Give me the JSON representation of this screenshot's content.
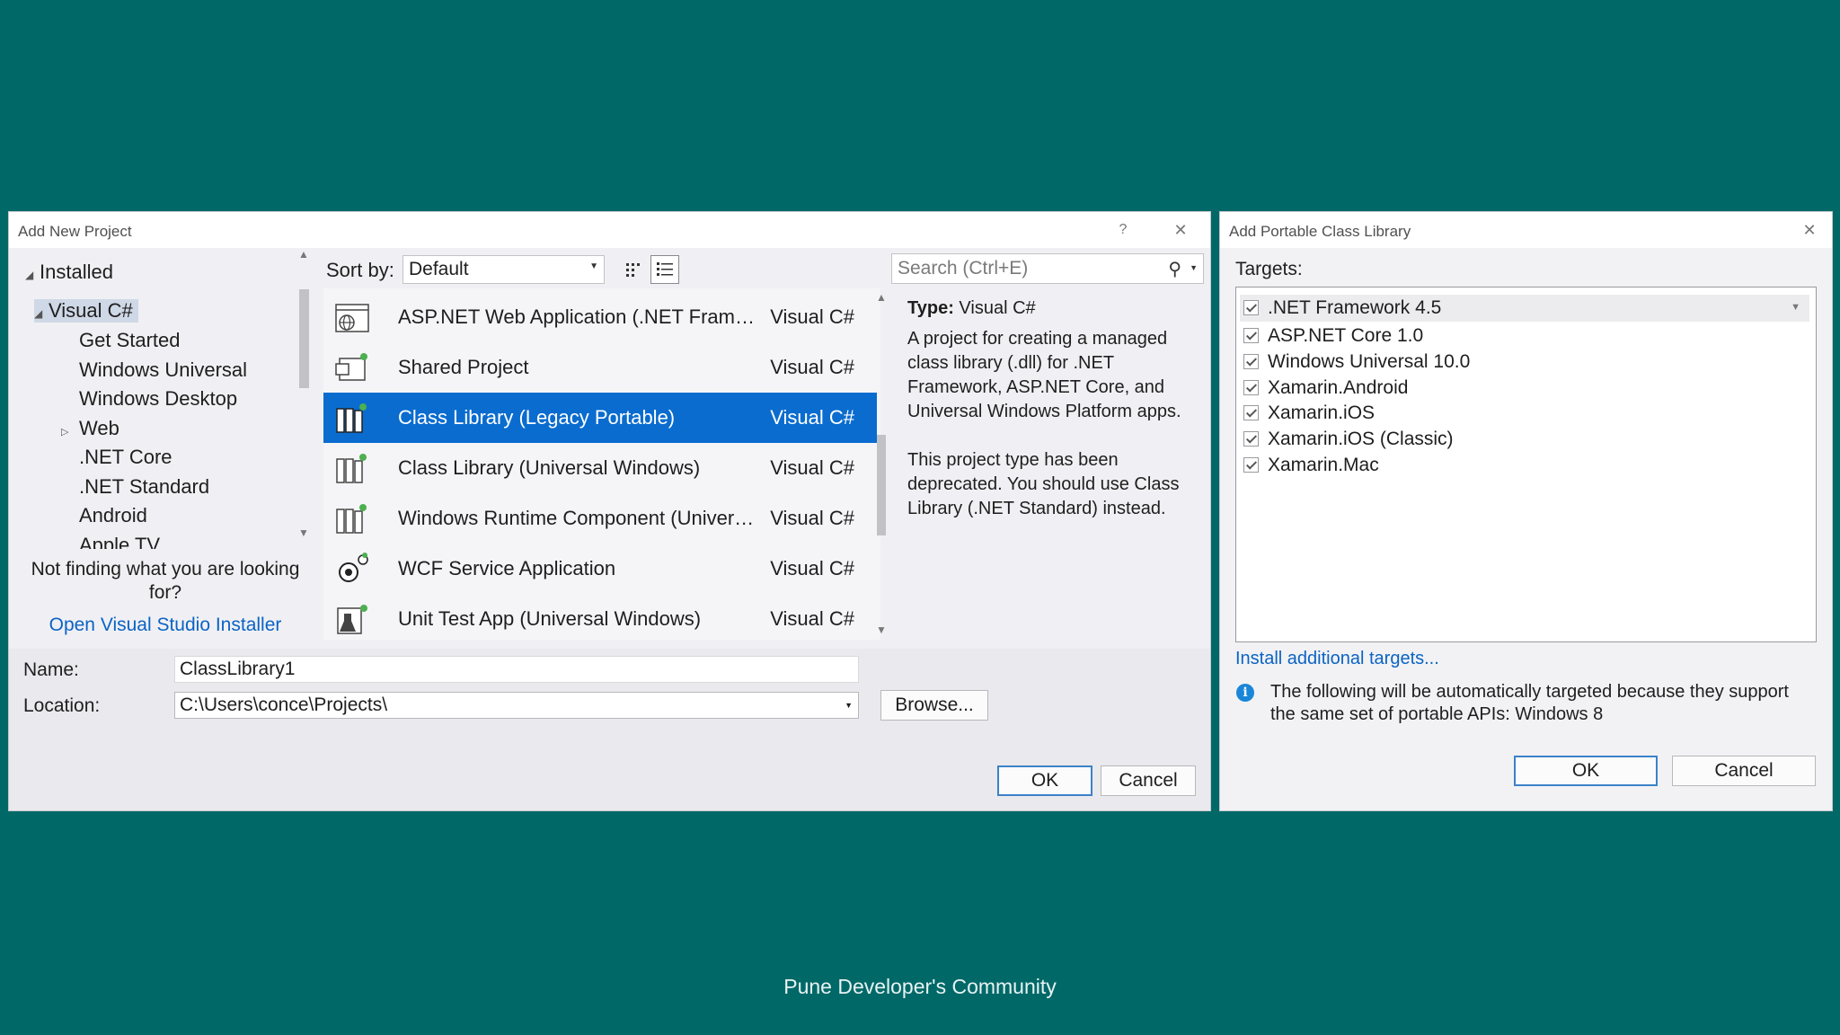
{
  "new_project": {
    "title": "Add New Project",
    "help": "?",
    "close": "✕",
    "tree": {
      "installed": "Installed",
      "visual_csharp": "Visual C#",
      "children": [
        "Get Started",
        "Windows Universal",
        "Windows Desktop",
        "Web",
        ".NET Core",
        ".NET Standard",
        "Android",
        "Apple TV"
      ]
    },
    "not_finding": "Not finding what you are looking for?",
    "installer_link": "Open Visual Studio Installer",
    "sort_label": "Sort by:",
    "sort_value": "Default",
    "search_placeholder": "Search (Ctrl+E)",
    "templates": [
      {
        "name": "ASP.NET Web Application (.NET Fram…",
        "lang": "Visual C#",
        "icon": "web-app-icon"
      },
      {
        "name": "Shared Project",
        "lang": "Visual C#",
        "icon": "shared-project-icon"
      },
      {
        "name": "Class Library (Legacy Portable)",
        "lang": "Visual C#",
        "icon": "class-library-icon",
        "selected": true
      },
      {
        "name": "Class Library (Universal Windows)",
        "lang": "Visual C#",
        "icon": "class-library-icon"
      },
      {
        "name": "Windows Runtime Component (Univer…",
        "lang": "Visual C#",
        "icon": "runtime-component-icon"
      },
      {
        "name": "WCF Service Application",
        "lang": "Visual C#",
        "icon": "wcf-service-icon"
      },
      {
        "name": "Unit Test App (Universal Windows)",
        "lang": "Visual C#",
        "icon": "unit-test-icon"
      }
    ],
    "description": {
      "type_label": "Type:",
      "type_value": "Visual C#",
      "para1": "A project for creating a managed class library (.dll) for .NET Framework, ASP.NET Core, and Universal Windows Platform apps.",
      "para2": "This project type has been deprecated. You should use Class Library (.NET Standard) instead."
    },
    "name_label": "Name:",
    "name_value": "ClassLibrary1",
    "location_label": "Location:",
    "location_value": "C:\\Users\\conce\\Projects\\",
    "browse": "Browse...",
    "ok": "OK",
    "cancel": "Cancel"
  },
  "pcl": {
    "title": "Add Portable Class Library",
    "close": "✕",
    "targets_label": "Targets:",
    "targets": [
      ".NET Framework 4.5",
      "ASP.NET Core 1.0",
      "Windows Universal 10.0",
      "Xamarin.Android",
      "Xamarin.iOS",
      "Xamarin.iOS (Classic)",
      "Xamarin.Mac"
    ],
    "install_link": "Install additional targets...",
    "info_text": "The following will be automatically targeted because they support the same set of portable APIs: Windows 8",
    "ok": "OK",
    "cancel": "Cancel"
  },
  "footer": "Pune Developer's Community",
  "colors": {
    "background": "#016868",
    "selection": "#0a6ccf",
    "link": "#0b63c4"
  }
}
